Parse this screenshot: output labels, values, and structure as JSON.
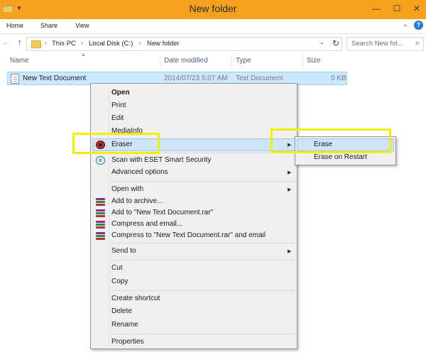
{
  "window": {
    "title": "New folder",
    "controls": {
      "minimize": "—",
      "maximize": "☐",
      "close": "✕"
    }
  },
  "ribbon": {
    "tabs": [
      "Home",
      "Share",
      "View"
    ],
    "expand_glyph": "⌄",
    "help_glyph": "?"
  },
  "navigation": {
    "back": "←",
    "forward": "→",
    "up": "↑",
    "breadcrumb": [
      "This PC",
      "Local Disk (C:)",
      "New folder"
    ],
    "separator": "›",
    "dropdown": "⌄",
    "refresh": "↻",
    "search_placeholder": "Search New fol..."
  },
  "columns": [
    "Name",
    "Date modified",
    "Type",
    "Size"
  ],
  "files": [
    {
      "name": "New Text Document",
      "date": "2014/07/23 5:07 AM",
      "type": "Text Document",
      "size": "0 KB"
    }
  ],
  "context_menu": {
    "items": {
      "open": "Open",
      "print": "Print",
      "edit": "Edit",
      "mediainfo": "MediaInfo",
      "eraser": "Eraser",
      "scan": "Scan with ESET Smart Security",
      "advanced": "Advanced options",
      "open_with": "Open with",
      "add_archive": "Add to archive...",
      "add_rar": "Add to \"New Text Document.rar\"",
      "compress_email": "Compress and email...",
      "compress_rar_email": "Compress to \"New Text Document.rar\" and email",
      "send_to": "Send to",
      "cut": "Cut",
      "copy": "Copy",
      "create_shortcut": "Create shortcut",
      "delete": "Delete",
      "rename": "Rename",
      "properties": "Properties"
    },
    "submenu_arrow": "▶"
  },
  "eraser_submenu": [
    "Erase",
    "Erase on Restart"
  ],
  "colors": {
    "titlebar": "#f6a11d",
    "selection": "#cce8ff",
    "menu_bg": "#f0f0f0",
    "annotation": "#f4ef00"
  }
}
